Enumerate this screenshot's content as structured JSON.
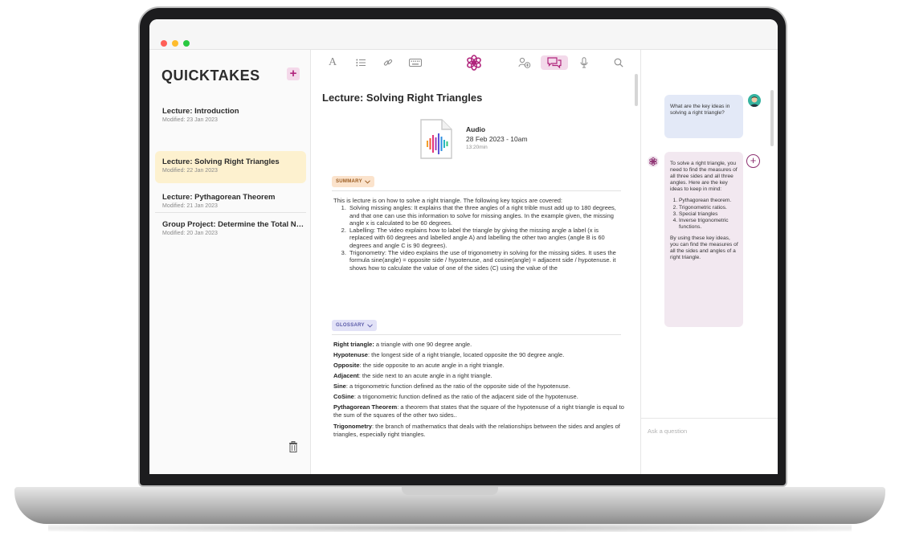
{
  "colors": {
    "accent": "#b0247c",
    "active_note": "#fdf1cf",
    "summary_pill": "#fbe3cc",
    "glossary_pill": "#e2e2f7",
    "user_bubble": "#e3e9f7",
    "ai_bubble": "#f2e8f0"
  },
  "window": {
    "traffic_lights": [
      "#ff5f57",
      "#febc2e",
      "#28c840"
    ]
  },
  "sidebar": {
    "title": "QUICKTAKES",
    "add_label": "+",
    "notes": [
      {
        "title": "Lecture: Introduction",
        "date": "Modified: 23 Jan 2023",
        "active": false
      },
      {
        "title": "Lecture: Solving Right Triangles",
        "date": "Modified: 22 Jan 2023",
        "active": true
      },
      {
        "title": "Lecture: Pythagorean Theorem",
        "date": "Modified: 21 Jan 2023",
        "active": false
      },
      {
        "title": "Group Project: Determine the Total Number of Students",
        "date": "Modified: 20 Jan 2023",
        "active": false
      }
    ],
    "trash_icon": "trash-icon"
  },
  "toolbar": {
    "icons": [
      "text-format-icon",
      "list-icon",
      "link-icon",
      "keyboard-icon",
      "openai-logo-icon",
      "add-person-icon",
      "chat-icon",
      "microphone-icon",
      "search-icon"
    ],
    "font_label": "A"
  },
  "doc": {
    "title": "Lecture: Solving Right Triangles",
    "audio": {
      "label": "Audio",
      "date": "28 Feb 2023 - 10am",
      "length": "13:20min"
    },
    "summary_label": "SUMMARY",
    "summary_intro": "This is lecture is on how to solve a right triangle. The following key topics are covered:",
    "summary_items": [
      "Solving missing angles: It explains that the three angles of a right trible must add up to 180 degrees, and that one can use this information to solve for missing angles. In the example given, the missing angle x is calculated to be 60 degrees.",
      "Labelling: The video explains how to label the triangle by giving the missing angle a label (x is replaced with 60 degrees and labelled angle A) and labelling the other two angles (angle B is 60 degrees and angle C is 90 degrees).",
      "Trigonometry: The video explains the use of trigonometry in solving for the missing sides. It uses the formula sine(angle) = opposite side / hypotenuse, and cosine(angle) = adjacent side / hypotenuse. it shows how to calculate the value of one of the sides (C) using the value of the"
    ],
    "glossary_label": "GLOSSARY",
    "glossary": [
      {
        "term": "Right triangle:",
        "def": " a triangle with one 90 degree angle."
      },
      {
        "term": "Hypotenuse",
        "def": ": the longest side of a right triangle, located opposite the 90 degree angle."
      },
      {
        "term": "Opposite",
        "def": ": the side opposite to an acute angle in a right triangle."
      },
      {
        "term": "Adjacent",
        "def": ": the side next to an acute angle in a right triangle."
      },
      {
        "term": "Sine",
        "def": ": a trigonometric function defined as the ratio of the opposite side of the hypotenuse."
      },
      {
        "term": "CoSine",
        "def": ": a trigonometric function defined as the ratio of the adjacent side of the hypotenuse."
      },
      {
        "term": "Pythagorean Theorem",
        "def": ": a theorem that states that the square of the hypotenuse of a right triangle is equal to the sum of the squares of the other two sides.."
      },
      {
        "term": "Trigonometry",
        "def": ": the branch of mathematics that deals with the relationships between the sides and angles of triangles, especially right triangles."
      }
    ]
  },
  "chat": {
    "user_message": "What are the key ideas in solving a right triangle?",
    "ai_intro": "To solve a right triangle, you need to find the measures of all three sides and all three angles. Here are the key ideas to keep in mind:",
    "ai_items": [
      "Pythagorean theorem.",
      "Trigonometric ratios.",
      "Special triangles",
      "Inverse trigonometric functions."
    ],
    "ai_outro": "By using these key ideas, you can find the measures of all the sides and angles of a right triangle.",
    "input_placeholder": "Ask a question"
  }
}
